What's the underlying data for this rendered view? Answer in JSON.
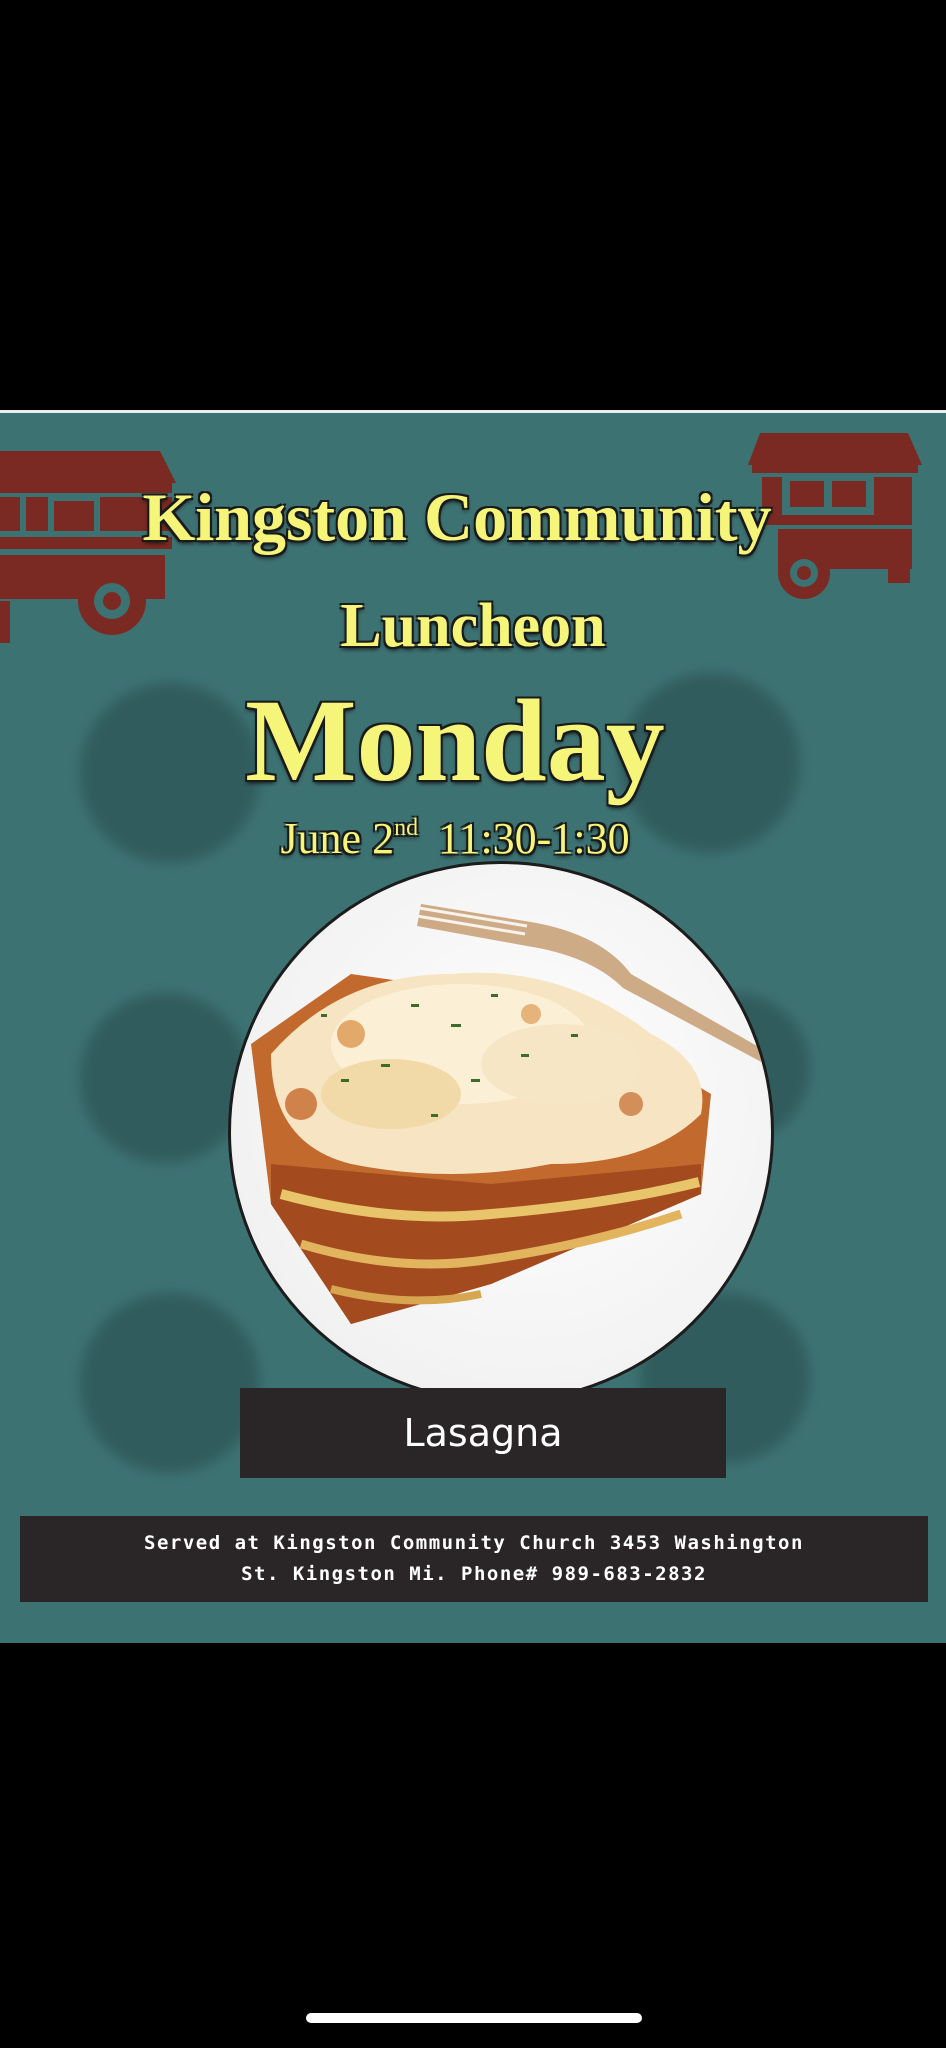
{
  "flyer": {
    "title": "Kingston Community",
    "subtitle": "Luncheon",
    "day": "Monday",
    "date_month_day": "June 2",
    "date_suffix": "nd",
    "time": "11:30-1:30",
    "dish": "Lasagna",
    "footer_line1": "Served at Kingston Community Church 3453 Washington",
    "footer_line2": "St. Kingston Mi. Phone# 989-683-2832"
  },
  "colors": {
    "background": "#3d7273",
    "title": "#f5f57a",
    "truck": "#7a2a22",
    "bar": "#2a2627"
  },
  "icons": [
    "food-truck-icon",
    "food-cart-icon",
    "lasagna-plate-image"
  ]
}
